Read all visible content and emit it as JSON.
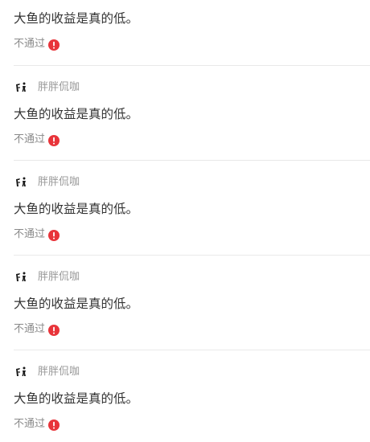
{
  "colors": {
    "text": "#333333",
    "muted": "#999999",
    "status": "#8a8a8a",
    "alert": "#e8343a",
    "divider": "#e9e9e9"
  },
  "posts": [
    {
      "username": "",
      "content": "大鱼的收益是真的低。",
      "status": "不通过",
      "status_icon": "error-circle-icon"
    },
    {
      "username": "胖胖侃咖",
      "content": "大鱼的收益是真的低。",
      "status": "不通过",
      "status_icon": "error-circle-icon"
    },
    {
      "username": "胖胖侃咖",
      "content": "大鱼的收益是真的低。",
      "status": "不通过",
      "status_icon": "error-circle-icon"
    },
    {
      "username": "胖胖侃咖",
      "content": "大鱼的收益是真的低。",
      "status": "不通过",
      "status_icon": "error-circle-icon"
    },
    {
      "username": "胖胖侃咖",
      "content": "大鱼的收益是真的低。",
      "status": "不通过",
      "status_icon": "error-circle-icon"
    }
  ]
}
